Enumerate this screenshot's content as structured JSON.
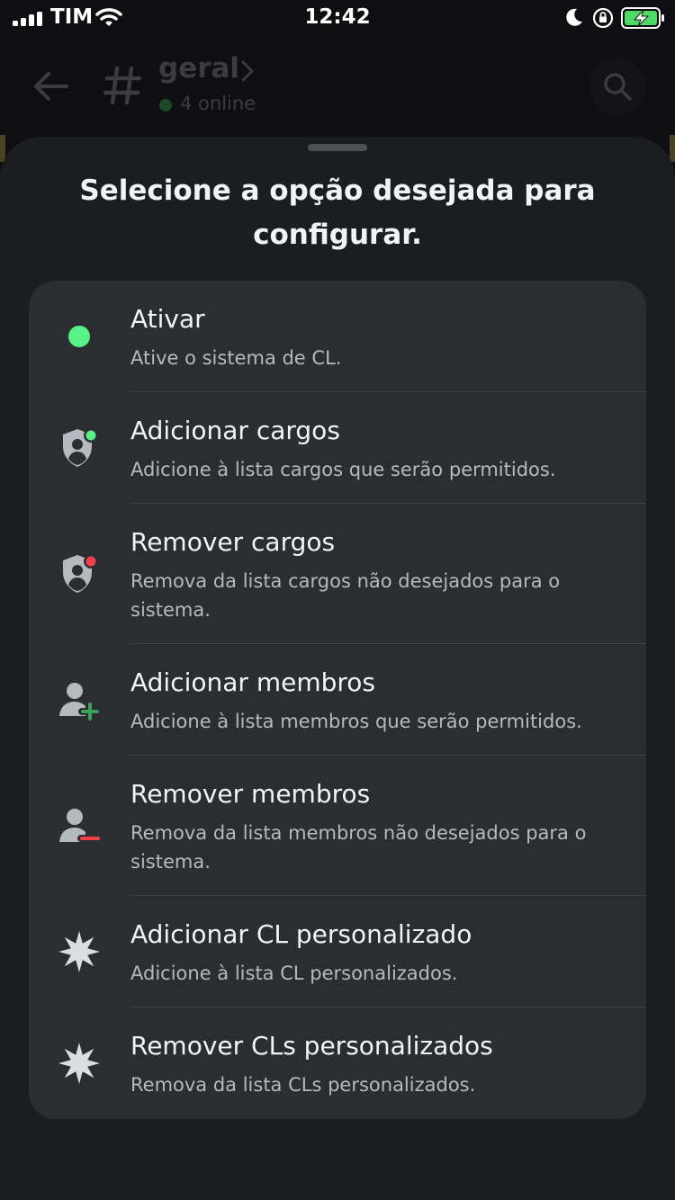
{
  "status_bar": {
    "carrier": "TIM",
    "time": "12:42"
  },
  "chat_header": {
    "channel_name": "geral",
    "online_text": "4 online"
  },
  "sheet": {
    "title": "Selecione a opção desejada para configurar.",
    "options": [
      {
        "title": "Ativar",
        "description": "Ative o sistema de CL.",
        "icon": "green-status-dot-icon"
      },
      {
        "title": "Adicionar cargos",
        "description": "Adicione à lista cargos que serão permitidos.",
        "icon": "role-shield-add-icon"
      },
      {
        "title": "Remover cargos",
        "description": "Remova da lista cargos não desejados para o sistema.",
        "icon": "role-shield-remove-icon"
      },
      {
        "title": "Adicionar membros",
        "description": "Adicione à lista membros que serão permitidos.",
        "icon": "user-add-icon"
      },
      {
        "title": "Remover membros",
        "description": "Remova da lista membros não desejados para o sistema.",
        "icon": "user-remove-icon"
      },
      {
        "title": "Adicionar CL personalizado",
        "description": "Adicione à lista CL personalizados.",
        "icon": "sparkle-icon"
      },
      {
        "title": "Remover CLs personalizados",
        "description": "Remova da lista CLs personalizados.",
        "icon": "sparkle-icon"
      }
    ]
  },
  "colors": {
    "sheet_background": "#1c1d21",
    "card_background": "#2b2d31",
    "green_status": "#57f287",
    "red_status": "#ed4245",
    "green_add": "#3ba55c",
    "muted_text": "#b5bac1"
  }
}
